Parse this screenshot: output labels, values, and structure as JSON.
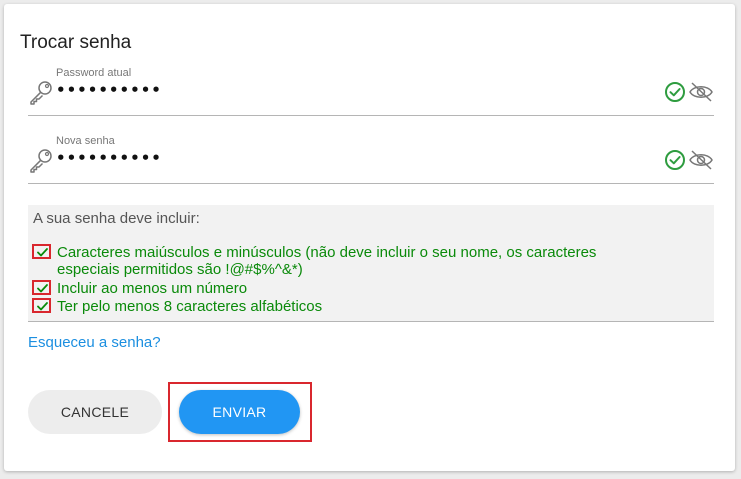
{
  "dialog": {
    "title": "Trocar senha"
  },
  "fields": {
    "current": {
      "label": "Password atual",
      "value": "••••••••••"
    },
    "new": {
      "label": "Nova senha",
      "value": "••••••••••"
    }
  },
  "rules": {
    "title": "A sua senha deve incluir:",
    "items": [
      {
        "line1": "Caracteres maiúsculos e minúsculos (não deve incluir o seu nome, os caracteres",
        "line2": "especiais permitidos são !@#$%^&*)"
      },
      {
        "line1": "Incluir ao menos um número"
      },
      {
        "line1": "Ter pelo menos 8 caracteres alfabéticos"
      }
    ]
  },
  "links": {
    "forgot": "Esqueceu a senha?"
  },
  "buttons": {
    "cancel": "CANCELE",
    "submit": "ENVIAR"
  },
  "colors": {
    "accent": "#2196f3",
    "valid": "#0a8a0a",
    "highlight": "#d9272e",
    "link": "#1c8fe0"
  },
  "icons": {
    "field_icon": "key-icon",
    "valid_icon": "check-circle-icon",
    "visibility_icon": "eye-slash-icon",
    "rule_icon": "checkmark-icon"
  }
}
